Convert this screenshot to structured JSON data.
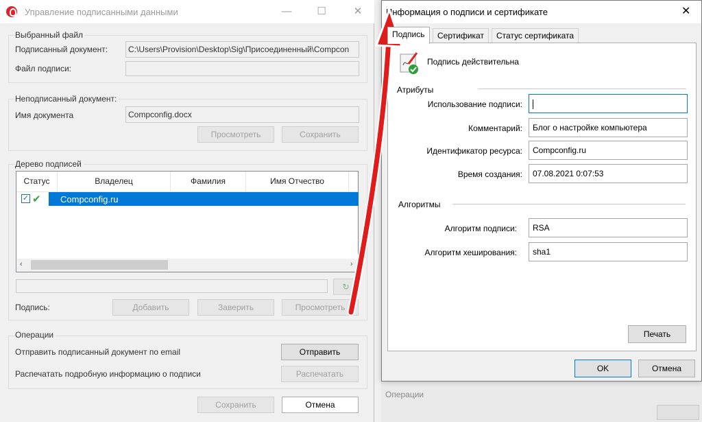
{
  "left_window": {
    "title": "Управление подписанными данными",
    "selected_file": {
      "group_label": "Выбранный файл",
      "signed_doc_label": "Подписанный документ:",
      "signed_doc_value": "C:\\Users\\Provision\\Desktop\\Sig\\Присоединенный\\Compcon",
      "sig_file_label": "Файл подписи:",
      "sig_file_value": ""
    },
    "unsigned_doc": {
      "group_label": "Неподписанный документ:",
      "name_label": "Имя документа",
      "name_value": "Compconfig.docx",
      "view_button": "Просмотреть",
      "save_button": "Сохранить"
    },
    "signature_tree": {
      "group_label": "Дерево подписей",
      "columns": [
        "Статус",
        "Владелец",
        "Фамилия",
        "Имя Отчество"
      ],
      "rows": [
        {
          "owner": "Compconfig.ru"
        }
      ],
      "signature_label": "Подпись:",
      "add_button": "Добавить",
      "certify_button": "Заверить",
      "view_button": "Просмотреть"
    },
    "operations": {
      "group_label": "Операции",
      "send_label": "Отправить подписанный документ по email",
      "send_button": "Отправить",
      "print_label": "Распечатать подробную информацию о подписи",
      "print_button": "Распечатать"
    },
    "footer": {
      "save_button": "Сохранить",
      "cancel_button": "Отмена"
    }
  },
  "right_window": {
    "title": "Информация о подписи и сертификате",
    "tabs": [
      "Подпись",
      "Сертификат",
      "Статус сертификата"
    ],
    "signature_status": "Подпись действительна",
    "attributes": {
      "section_label": "Атрибуты",
      "usage_label": "Использование подписи:",
      "usage_value": "",
      "comment_label": "Комментарий:",
      "comment_value": "Блог о настройке компьютера",
      "resource_label": "Идентификатор ресурса:",
      "resource_value": "Compconfig.ru",
      "created_label": "Время создания:",
      "created_value": "07.08.2021 0:07:53"
    },
    "algorithms": {
      "section_label": "Алгоритмы",
      "sig_alg_label": "Алгоритм подписи:",
      "sig_alg_value": "RSA",
      "hash_alg_label": "Алгоритм хеширования:",
      "hash_alg_value": "sha1"
    },
    "print_button": "Печать",
    "ok_button": "OK",
    "cancel_button": "Отмена"
  },
  "background_peek": {
    "operations_label": "Операции"
  },
  "colors": {
    "selection_blue": "#0078d7",
    "arrow_red": "#e01b1b"
  }
}
